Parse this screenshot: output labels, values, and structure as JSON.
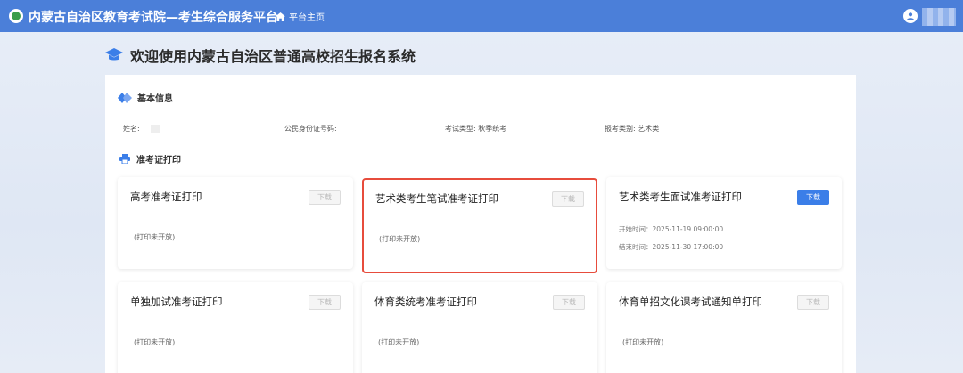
{
  "header": {
    "site_title": "内蒙古自治区教育考试院—考生综合服务平台",
    "home_label": "平台主页"
  },
  "page": {
    "title": "欢迎使用内蒙古自治区普通高校招生报名系统"
  },
  "basic_info": {
    "section_title": "基本信息",
    "name_label": "姓名:",
    "id_label": "公民身份证号码:",
    "exam_type_label": "考试类型:",
    "exam_type_value": "秋季统考",
    "category_label": "报考类别:",
    "category_value": "艺术类"
  },
  "admission": {
    "section_title": "准考证打印",
    "cards": [
      {
        "title": "高考准考证打印",
        "button": "下载",
        "status": "(打印未开放)"
      },
      {
        "title": "艺术类考生笔试准考证打印",
        "button": "下载",
        "status": "(打印未开放)"
      },
      {
        "title": "艺术类考生面试准考证打印",
        "button": "下载",
        "start_time": "开始时间：2025-11-19 09:00:00",
        "end_time": "结束时间：2025-11-30 17:00:00"
      },
      {
        "title": "单独加试准考证打印",
        "button": "下载",
        "status": "(打印未开放)"
      },
      {
        "title": "体育类统考准考证打印",
        "button": "下载",
        "status": "(打印未开放)"
      },
      {
        "title": "体育单招文化课考试通知单打印",
        "button": "下载",
        "status": "(打印未开放)"
      }
    ]
  },
  "colors": {
    "topbar": "#4b7fd9",
    "primary_button": "#3b7ee8",
    "highlight_border": "#e74c3c"
  }
}
